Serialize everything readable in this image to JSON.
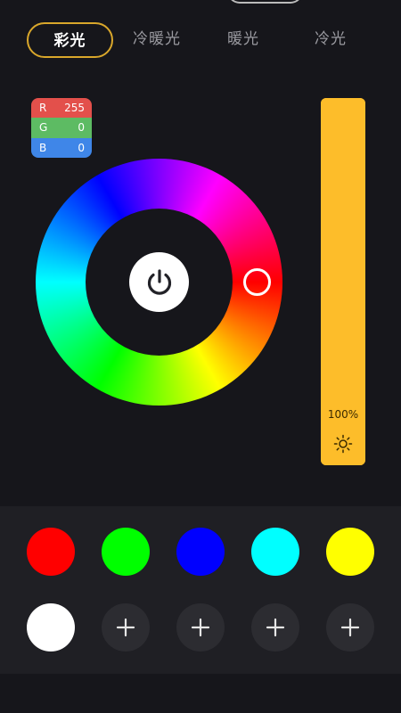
{
  "tabs": [
    {
      "label": "彩光",
      "active": true
    },
    {
      "label": "冷暖光",
      "active": false
    },
    {
      "label": "暖光",
      "active": false
    },
    {
      "label": "冷光",
      "active": false
    }
  ],
  "rgb": {
    "r": {
      "label": "R",
      "value": "255"
    },
    "g": {
      "label": "G",
      "value": "0"
    },
    "b": {
      "label": "B",
      "value": "0"
    }
  },
  "brightness": {
    "value_text": "100%",
    "level": 1.0,
    "icon": "sun-icon"
  },
  "power": {
    "icon": "power-icon"
  },
  "colors": {
    "accent": "#d9a72b",
    "brightness_bar": "#fdbd2a"
  },
  "palette": {
    "swatches": [
      {
        "color": "#ff0000"
      },
      {
        "color": "#00ff00"
      },
      {
        "color": "#0000ff"
      },
      {
        "color": "#00ffff"
      },
      {
        "color": "#ffff00"
      },
      {
        "color": "#ffffff"
      }
    ],
    "add_slots": 4,
    "add_icon": "plus-icon"
  }
}
